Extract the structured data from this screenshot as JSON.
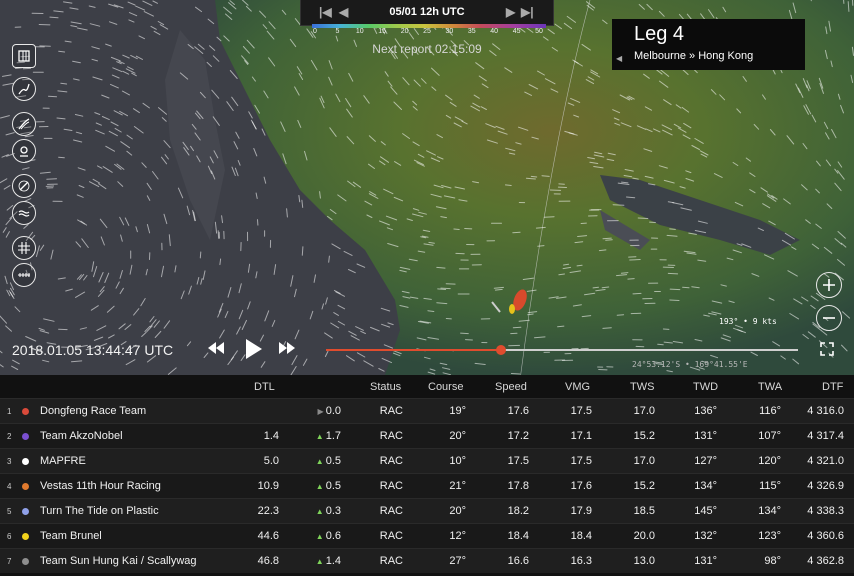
{
  "header": {
    "time_label": "05/01 12h UTC",
    "nav_first": "|◀",
    "nav_prev": "◀",
    "nav_next": "▶",
    "nav_last": "▶|",
    "scale_ticks": [
      "0",
      "5",
      "10",
      "15",
      "20",
      "25",
      "30",
      "35",
      "40",
      "45",
      "50"
    ],
    "next_report": "Next report 02:15:09"
  },
  "leg": {
    "title": "Leg 4",
    "route": "Melbourne » Hong Kong"
  },
  "map": {
    "wind_readout": "193° • 9 kts",
    "coords": "24°53.12'S • 169°41.55'E",
    "datetime": "2018.01.05 13:44:47 UTC",
    "timeline_progress": 0.37
  },
  "toolbar": {
    "icons": [
      "map-icon",
      "route-icon",
      "wind-icon",
      "tracker-icon",
      "compass-icon",
      "waves-icon",
      "grid-icon",
      "ruler-icon"
    ]
  },
  "colors": {
    "accent": "#e04c2e",
    "up_arrow": "#7fd35a",
    "flat_arrow": "#8a8a8a"
  },
  "table": {
    "columns": [
      "DTL",
      "Status",
      "Course",
      "Speed",
      "VMG",
      "TWS",
      "TWD",
      "TWA",
      "DTF"
    ],
    "rows": [
      {
        "rank": "1",
        "color": "#d94a3a",
        "name": "Dongfeng Race Team",
        "dtl": "",
        "change": "0.0",
        "trend": "flat",
        "status": "RAC",
        "course": "19°",
        "speed": "17.6",
        "vmg": "17.5",
        "tws": "17.0",
        "twd": "136°",
        "twa": "116°",
        "dtf": "4 316.0"
      },
      {
        "rank": "2",
        "color": "#7a4fd0",
        "name": "Team AkzoNobel",
        "dtl": "1.4",
        "change": "1.7",
        "trend": "up",
        "status": "RAC",
        "course": "20°",
        "speed": "17.2",
        "vmg": "17.1",
        "tws": "15.2",
        "twd": "131°",
        "twa": "107°",
        "dtf": "4 317.4"
      },
      {
        "rank": "3",
        "color": "#ffffff",
        "name": "MAPFRE",
        "dtl": "5.0",
        "change": "0.5",
        "trend": "up",
        "status": "RAC",
        "course": "10°",
        "speed": "17.5",
        "vmg": "17.5",
        "tws": "17.0",
        "twd": "127°",
        "twa": "120°",
        "dtf": "4 321.0"
      },
      {
        "rank": "4",
        "color": "#e07a2e",
        "name": "Vestas 11th Hour Racing",
        "dtl": "10.9",
        "change": "0.5",
        "trend": "up",
        "status": "RAC",
        "course": "21°",
        "speed": "17.8",
        "vmg": "17.6",
        "tws": "15.2",
        "twd": "134°",
        "twa": "115°",
        "dtf": "4 326.9"
      },
      {
        "rank": "5",
        "color": "#8fa0e8",
        "name": "Turn The Tide on Plastic",
        "dtl": "22.3",
        "change": "0.3",
        "trend": "up",
        "status": "RAC",
        "course": "20°",
        "speed": "18.2",
        "vmg": "17.9",
        "tws": "18.5",
        "twd": "145°",
        "twa": "134°",
        "dtf": "4 338.3"
      },
      {
        "rank": "6",
        "color": "#f1d21c",
        "name": "Team Brunel",
        "dtl": "44.6",
        "change": "0.6",
        "trend": "up",
        "status": "RAC",
        "course": "12°",
        "speed": "18.4",
        "vmg": "18.4",
        "tws": "20.0",
        "twd": "132°",
        "twa": "123°",
        "dtf": "4 360.6"
      },
      {
        "rank": "7",
        "color": "#8e8e8e",
        "name": "Team Sun Hung Kai / Scallywag",
        "dtl": "46.8",
        "change": "1.4",
        "trend": "up",
        "status": "RAC",
        "course": "27°",
        "speed": "16.6",
        "vmg": "16.3",
        "tws": "13.0",
        "twd": "131°",
        "twa": "98°",
        "dtf": "4 362.8"
      }
    ]
  }
}
